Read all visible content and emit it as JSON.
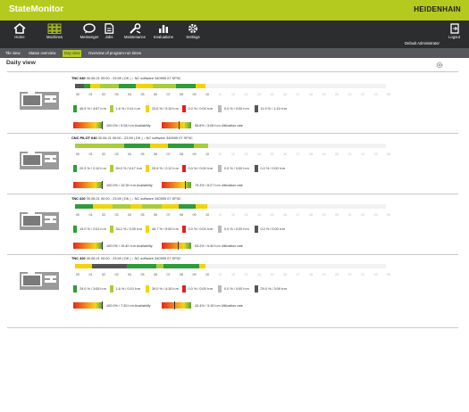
{
  "app": {
    "title": "StateMonitor",
    "vendor": "HEIDENHAIN"
  },
  "nav": {
    "items": [
      {
        "label": "Home",
        "icon": "home-icon"
      },
      {
        "label": "Machines",
        "icon": "machines-icon"
      },
      {
        "label": "Messenger",
        "icon": "messenger-icon"
      },
      {
        "label": "Jobs",
        "icon": "jobs-icon"
      },
      {
        "label": "Maintenance",
        "icon": "maintenance-icon"
      },
      {
        "label": "Evaluations",
        "icon": "evaluations-icon"
      },
      {
        "label": "Settings",
        "icon": "settings-icon"
      }
    ],
    "user": "Default Administrator",
    "logout": "Logout"
  },
  "tabs": [
    {
      "label": "Tile view",
      "active": false
    },
    {
      "label": "Status overview",
      "active": false
    },
    {
      "label": "Day view",
      "active": true
    },
    {
      "label": "Overview of program-run times",
      "active": false
    }
  ],
  "page": {
    "title": "Daily view"
  },
  "colors": {
    "brand": "#b4ca1f",
    "green": "#2f9b3b",
    "lightgreen": "#a8cc3c",
    "yellow": "#f2d40a",
    "red": "#e21f1f",
    "grey": "#b9b9b9",
    "darkgrey": "#555555",
    "navbar": "#2c2d2f"
  },
  "hours": [
    "00",
    "01",
    "02",
    "03",
    "04",
    "05",
    "06",
    "07",
    "08",
    "09",
    "10",
    "11",
    "12",
    "13",
    "14",
    "15",
    "16",
    "17",
    "18",
    "19",
    "20",
    "21",
    "22",
    "23",
    "00"
  ],
  "machines": [
    {
      "name": "TNC 640",
      "info": " 30.06.21 00:00 - 23:59  |  DK  |  ↓ NC software  340595 07 SP3C",
      "current_hour": 10,
      "segments": [
        [
          "#555555",
          0,
          0.7
        ],
        [
          "#2f9b3b",
          0.7,
          1.2
        ],
        [
          "#f2d40a",
          1.2,
          1.9
        ],
        [
          "#a8cc3c",
          1.9,
          3.4
        ],
        [
          "#2f9b3b",
          3.4,
          4.7
        ],
        [
          "#f2d40a",
          4.7,
          6.0
        ],
        [
          "#a8cc3c",
          6.0,
          7.8
        ],
        [
          "#2f9b3b",
          7.8,
          9.3
        ],
        [
          "#f2d40a",
          9.3,
          10.1
        ]
      ],
      "legend": [
        {
          "color": "#2f9b3b",
          "text": "46.5 % / 4:57 h:m"
        },
        {
          "color": "#a8cc3c",
          "text": "1.6 % / 0:11 h:m"
        },
        {
          "color": "#f2d40a",
          "text": "20.6 % / 0:15 h:m"
        },
        {
          "color": "#e21f1f",
          "text": "0.0 % / 0:00 h:m"
        },
        {
          "color": "#b9b9b9",
          "text": "0.0 % / 0:00 h:m"
        },
        {
          "color": "#555555",
          "text": "11.9 % / 1:15 h:m"
        }
      ],
      "availability": {
        "value": 100.0,
        "text": "100.0% / 9:28 h:m Availability"
      },
      "utilization": {
        "value": 56.8,
        "text": "56.8% / 3:08 h:m Utilization rate"
      }
    },
    {
      "name": "CNC PILOT 640",
      "info": " 30.06.21 00:00 - 23:59  |  DK  |  ↓ NC software  340595 07 SP3C",
      "current_hour": 10,
      "segments": [
        [
          "#a8cc3c",
          0,
          3.8
        ],
        [
          "#2f9b3b",
          3.8,
          5.8
        ],
        [
          "#f2d40a",
          5.8,
          7.2
        ],
        [
          "#2f9b3b",
          7.2,
          9.2
        ],
        [
          "#a8cc3c",
          9.2,
          10.3
        ]
      ],
      "legend": [
        {
          "color": "#2f9b3b",
          "text": "20.3 % / 2:10 h:m"
        },
        {
          "color": "#a8cc3c",
          "text": "59.0 % / 6:17 h:m"
        },
        {
          "color": "#f2d40a",
          "text": "20.6 % / 2:12 h:m"
        },
        {
          "color": "#e21f1f",
          "text": "0.0 % / 0:00 h:m"
        },
        {
          "color": "#b9b9b9",
          "text": "0.0 % / 0:00 h:m"
        },
        {
          "color": "#555555",
          "text": "0.0 % / 0:00 h:m"
        }
      ],
      "availability": {
        "value": 100.0,
        "text": "100.0% / 10:39 h:m Availability"
      },
      "utilization": {
        "value": 79.3,
        "text": "79.3% / 8:27 h:m Utilization rate"
      }
    },
    {
      "name": "TNC 620",
      "info": " 30.06.21 00:00 - 23:59  |  DK  |  ↓ NC software  340595 07 SP3C",
      "current_hour": 10,
      "segments": [
        [
          "#2f9b3b",
          0,
          1.4
        ],
        [
          "#f2d40a",
          1.4,
          2.9
        ],
        [
          "#a8cc3c",
          2.9,
          4.3
        ],
        [
          "#f2d40a",
          4.3,
          5.2
        ],
        [
          "#a8cc3c",
          5.2,
          6.7
        ],
        [
          "#f2d40a",
          6.7,
          8.0
        ],
        [
          "#2f9b3b",
          8.0,
          9.3
        ],
        [
          "#f2d40a",
          9.3,
          10.2
        ]
      ],
      "legend": [
        {
          "color": "#2f9b3b",
          "text": "19.0 % / 2:01 h:m"
        },
        {
          "color": "#a8cc3c",
          "text": "34.2 % / 3:39 h:m"
        },
        {
          "color": "#f2d40a",
          "text": "46.7 % / 5:00 h:m"
        },
        {
          "color": "#e21f1f",
          "text": "0.0 % / 0:00 h:m"
        },
        {
          "color": "#b9b9b9",
          "text": "0.0 % / 0:00 h:m"
        },
        {
          "color": "#555555",
          "text": "0.0 % / 0:00 h:m"
        }
      ],
      "availability": {
        "value": 100.0,
        "text": "100.0% / 10:40 h:m Availability"
      },
      "utilization": {
        "value": 53.2,
        "text": "53.2% / 5:40 h:m Utilization rate"
      }
    },
    {
      "name": "TNC 320",
      "info": " 30.06.21 00:00 - 23:59  |  DK  |  ↓ NC software  340595 07 SP3C",
      "current_hour": 10,
      "segments": [
        [
          "#f2d40a",
          0,
          1.3
        ],
        [
          "#555555",
          1.3,
          4.0
        ],
        [
          "#2f9b3b",
          4.0,
          6.3
        ],
        [
          "#a8cc3c",
          6.3,
          6.8
        ],
        [
          "#2f9b3b",
          6.8,
          9.6
        ],
        [
          "#f2d40a",
          9.6,
          10.1
        ]
      ],
      "legend": [
        {
          "color": "#2f9b3b",
          "text": "29.0 % / 3:05 h:m"
        },
        {
          "color": "#a8cc3c",
          "text": "1.6 % / 0:10 h:m"
        },
        {
          "color": "#f2d40a",
          "text": "39.0 % / 4:15 h:m"
        },
        {
          "color": "#e21f1f",
          "text": "0.0 % / 0:00 h:m"
        },
        {
          "color": "#b9b9b9",
          "text": "0.0 % / 0:00 h:m"
        },
        {
          "color": "#555555",
          "text": "29.0 % / 3:09 h:m"
        }
      ],
      "availability": {
        "value": 100.0,
        "text": "100.0% / 7:30 h:m Availability"
      },
      "utilization": {
        "value": 43.4,
        "text": "43.4% / 3:15 h:m Utilization rate"
      }
    }
  ]
}
